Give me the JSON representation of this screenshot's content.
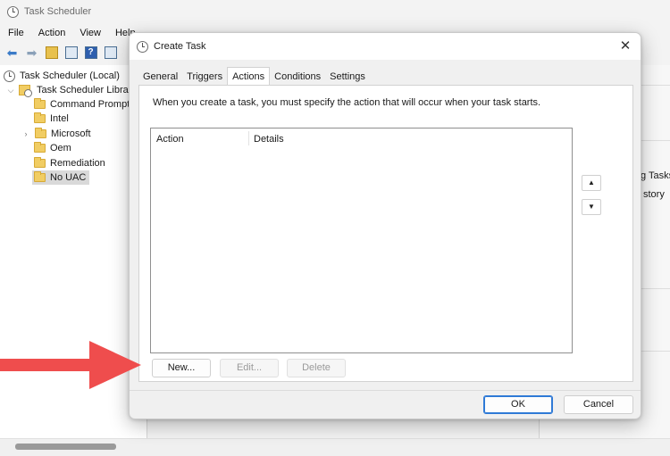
{
  "background_window": {
    "title": "Task Scheduler",
    "menu": [
      "File",
      "Action",
      "View",
      "Help"
    ],
    "tree": {
      "root": "Task Scheduler (Local)",
      "library": "Task Scheduler Library",
      "folders": [
        "Command Prompt",
        "Intel",
        "Microsoft",
        "Oem",
        "Remediation",
        "No UAC"
      ],
      "selected": "No UAC"
    },
    "actions_pane": {
      "partial_item_1": "g Tasks",
      "partial_item_2": "story"
    }
  },
  "dialog": {
    "title": "Create Task",
    "close_glyph": "✕",
    "tabs": [
      "General",
      "Triggers",
      "Actions",
      "Conditions",
      "Settings"
    ],
    "active_tab": "Actions",
    "intro_text": "When you create a task, you must specify the action that will occur when your task starts.",
    "columns": [
      "Action",
      "Details"
    ],
    "move_up_glyph": "▲",
    "move_down_glyph": "▼",
    "buttons": {
      "new": "New...",
      "edit": "Edit...",
      "delete": "Delete",
      "ok": "OK",
      "cancel": "Cancel"
    }
  },
  "colors": {
    "annotation_arrow": "#ef4d4d",
    "default_button_border": "#2f7ad6"
  }
}
